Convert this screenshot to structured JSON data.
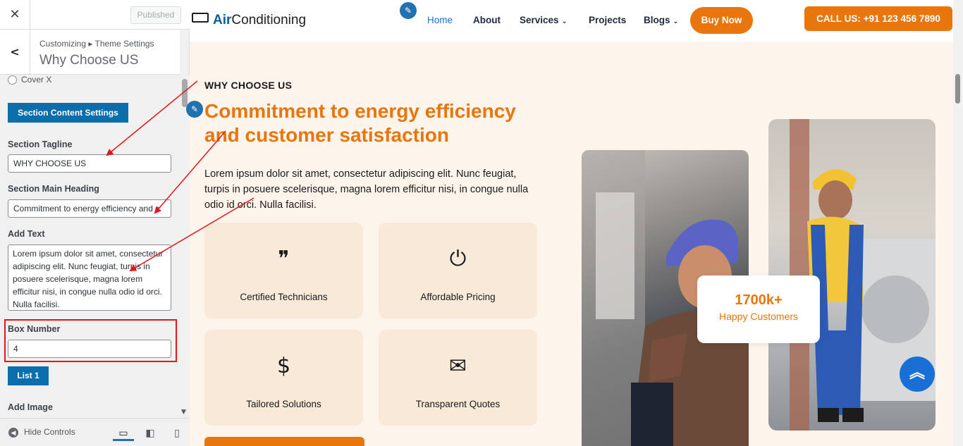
{
  "panel": {
    "close_icon": "close-icon",
    "publish_label": "Published",
    "breadcrumb": "Customizing ▸ Theme Settings",
    "title": "Why Choose US",
    "cover_label": "Cover X",
    "section_button": "Section Content Settings",
    "tagline_label": "Section Tagline",
    "tagline_value": "WHY CHOOSE US",
    "heading_label": "Section Main Heading",
    "heading_value": "Commitment to energy efficiency and c",
    "text_label": "Add Text",
    "text_value": "Lorem ipsum dolor sit amet, consectetur adipiscing elit. Nunc feugiat, turpis in posuere scelerisque, magna lorem efficitur nisi, in congue nulla odio id orci. Nulla facilisi.",
    "box_number_label": "Box Number",
    "box_number_value": "4",
    "list_button": "List 1",
    "add_image_label": "Add Image",
    "hide_controls": "Hide Controls"
  },
  "site": {
    "logo_brand": "Air",
    "logo_rest": "Conditioning",
    "nav": {
      "home": "Home",
      "about": "About",
      "services": "Services",
      "projects": "Projects",
      "blogs": "Blogs"
    },
    "buy_now": "Buy Now",
    "call": "CALL US: +91 123 456 7890",
    "tagline": "WHY CHOOSE US",
    "heading": "Commitment to energy efficiency and customer satisfaction",
    "paragraph": "Lorem ipsum dolor sit amet, consectetur adipiscing elit. Nunc feugiat, turpis in posuere scelerisque, magna lorem efficitur nisi, in congue nulla odio id orci. Nulla facilisi.",
    "features": [
      {
        "label": "Certified Technicians",
        "icon": "quote-badge-icon"
      },
      {
        "label": "Affordable Pricing",
        "icon": "power-button-icon"
      },
      {
        "label": "Tailored Solutions",
        "icon": "dollar-icon"
      },
      {
        "label": "Transparent Quotes",
        "icon": "certificate-mail-icon"
      }
    ],
    "stat_number": "1700k+",
    "stat_label": "Happy Customers"
  },
  "colors": {
    "accent": "#e8760c",
    "wp_blue": "#0a6eac",
    "section_bg": "#fdf4eb",
    "annotation_red": "#e01818"
  }
}
